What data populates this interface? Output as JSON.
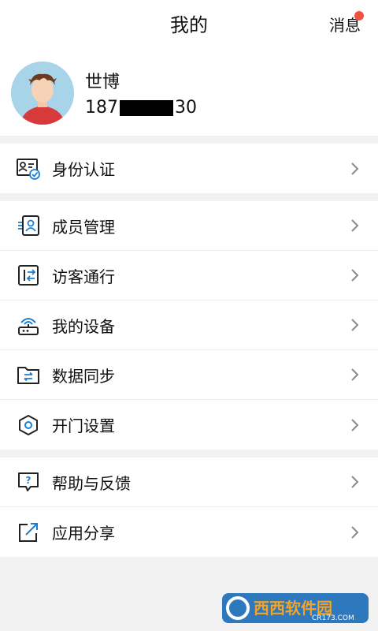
{
  "header": {
    "title": "我的",
    "messages_label": "消息"
  },
  "profile": {
    "name": "世博",
    "phone_prefix": "187",
    "phone_suffix": "30"
  },
  "menu_groups": [
    [
      {
        "label": "身份认证",
        "icon": "id-card-check-icon"
      }
    ],
    [
      {
        "label": "成员管理",
        "icon": "member-card-icon"
      },
      {
        "label": "访客通行",
        "icon": "visitor-pass-icon"
      },
      {
        "label": "我的设备",
        "icon": "router-device-icon"
      },
      {
        "label": "数据同步",
        "icon": "folder-sync-icon"
      },
      {
        "label": "开门设置",
        "icon": "hexagon-settings-icon"
      }
    ],
    [
      {
        "label": "帮助与反馈",
        "icon": "help-bubble-icon"
      },
      {
        "label": "应用分享",
        "icon": "share-external-icon"
      }
    ]
  ],
  "watermark": {
    "brand": "西西软件园",
    "site": "CR173.COM"
  },
  "colors": {
    "accent": "#1a7fd4",
    "badge": "#f0523f",
    "background": "#f2f2f2"
  }
}
